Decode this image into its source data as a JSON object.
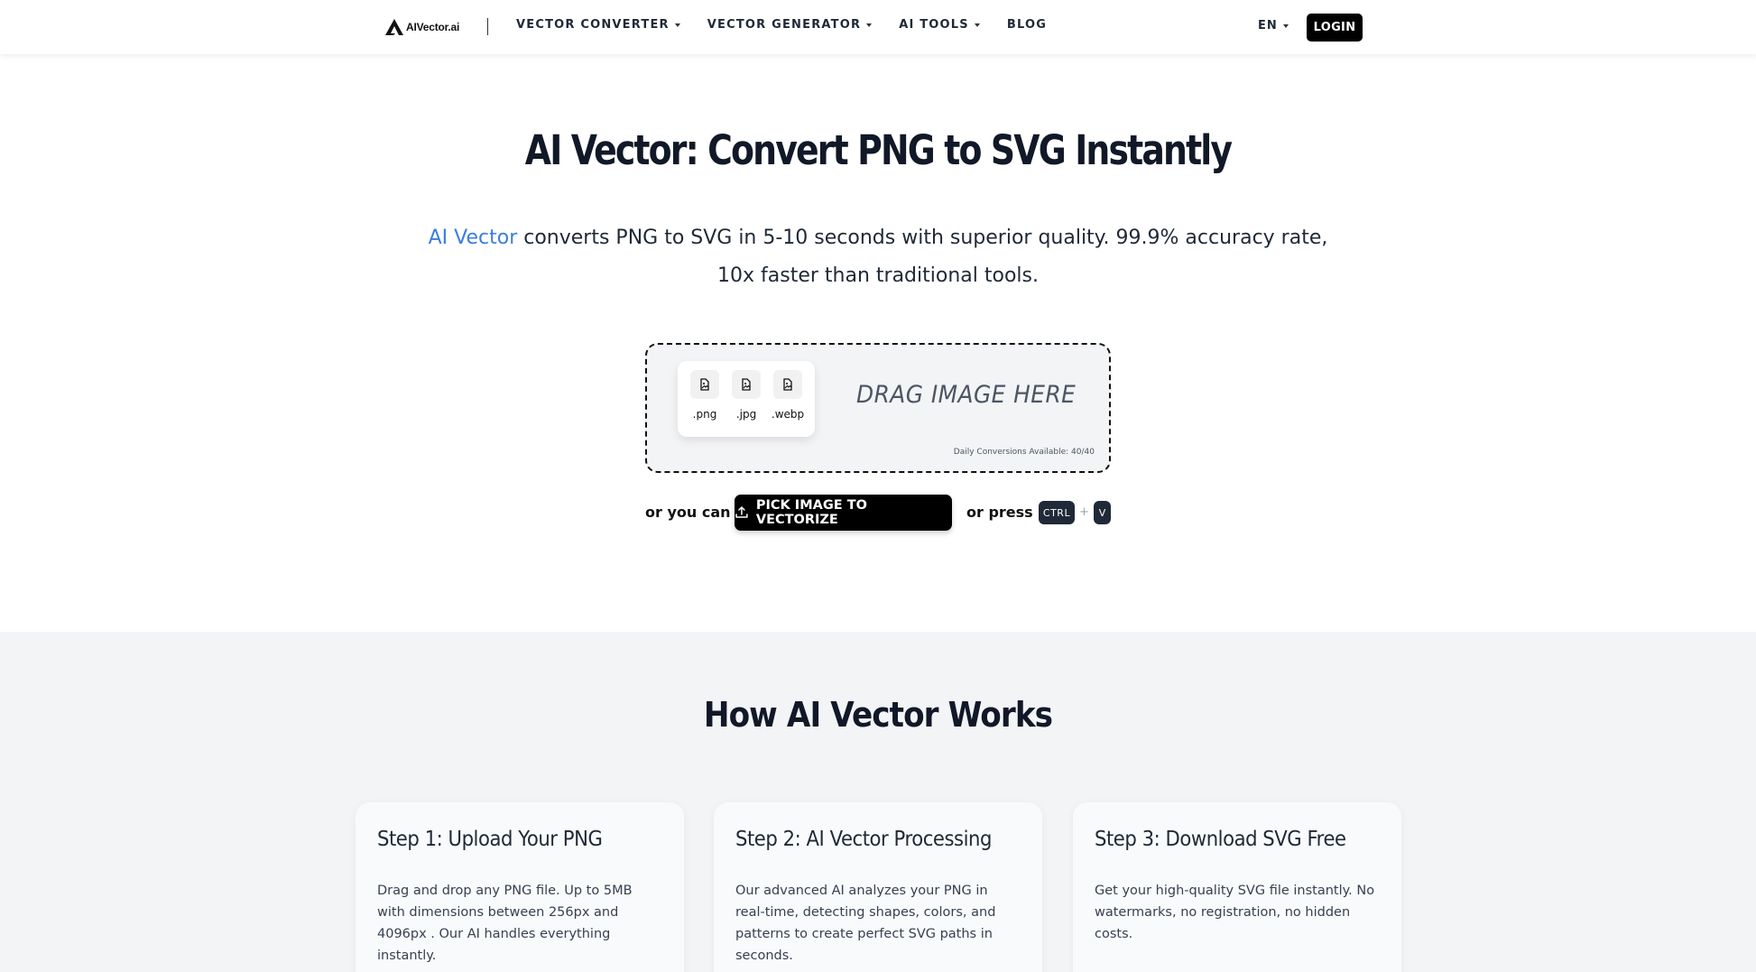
{
  "nav": {
    "logo_text": "AIVector.ai",
    "items": [
      {
        "label": "VECTOR CONVERTER",
        "dropdown": true
      },
      {
        "label": "VECTOR GENERATOR",
        "dropdown": true
      },
      {
        "label": "AI TOOLS",
        "dropdown": true
      },
      {
        "label": "BLOG",
        "dropdown": false
      }
    ],
    "language": "EN",
    "login_label": "LOGIN"
  },
  "hero": {
    "title": "AI Vector: Convert PNG to SVG Instantly",
    "subtitle_accent": "AI Vector",
    "subtitle_rest": " converts PNG to SVG in 5-10 seconds with superior quality. 99.9% accuracy rate, 10x faster than traditional tools."
  },
  "dropzone": {
    "formats": [
      ".png",
      ".jpg",
      ".webp"
    ],
    "drag_text": "DRAG IMAGE HERE",
    "daily_label": "Daily Conversions Available: 40/40"
  },
  "actions": {
    "or_you_can": "or you can",
    "pick_label": "PICK IMAGE TO VECTORIZE",
    "or_press": "or press",
    "key_ctrl": "CTRL",
    "key_plus": "+",
    "key_v": "V"
  },
  "how": {
    "title": "How AI Vector Works",
    "steps": [
      {
        "title": "Step 1: Upload Your PNG",
        "text": "Drag and drop any PNG file. Up to 5MB with dimensions between 256px and 4096px . Our AI handles everything instantly."
      },
      {
        "title": "Step 2: AI Vector Processing",
        "text": "Our advanced AI analyzes your PNG in real-time, detecting shapes, colors, and patterns to create perfect SVG paths in seconds."
      },
      {
        "title": "Step 3: Download SVG Free",
        "text": "Get your high-quality SVG file instantly. No watermarks, no registration, no hidden costs."
      }
    ]
  },
  "colors": {
    "accent": "#3b7ddd",
    "primary_button": "#000000",
    "section_bg": "#f3f4f6"
  }
}
